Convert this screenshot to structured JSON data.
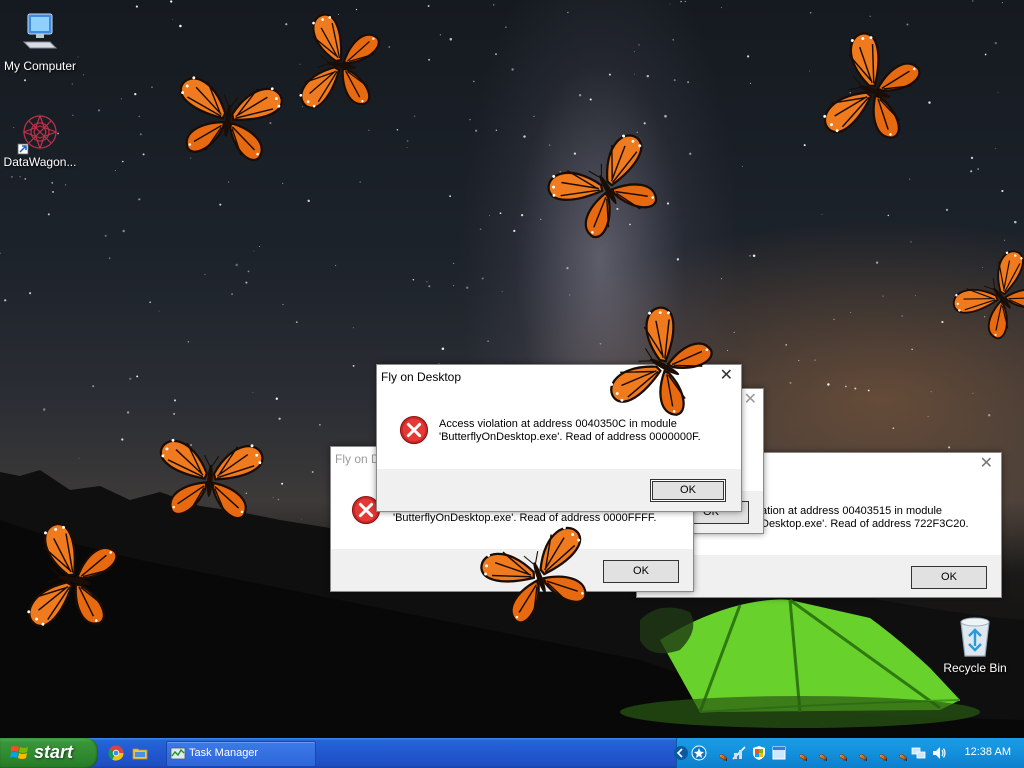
{
  "desktop": {
    "icons": [
      {
        "label": "My Computer",
        "icon": "my-computer-icon"
      },
      {
        "label": "DataWagon...",
        "icon": "datawagon-icon"
      },
      {
        "label": "Recycle Bin",
        "icon": "recycle-bin-icon"
      }
    ]
  },
  "dialogs": [
    {
      "title": "Fly on Desktop",
      "line1": "Access violation at address 0040350C in module",
      "line2": "'ButterflyOnDesktop.exe'. Read of address 0000000F.",
      "ok_label": "OK"
    },
    {
      "title": "Fly on D",
      "line1": "",
      "line2": "'ButterflyOnDesktop.exe'. Read of address 0000FFFF.",
      "ok_label": "OK"
    },
    {
      "title": "",
      "line1": "ation at address 00403515 in module",
      "line2": "Desktop.exe'. Read of address 722F3C20.",
      "ok_label": "OK"
    },
    {
      "title": "",
      "ok_label": "OK"
    }
  ],
  "taskbar": {
    "start_label": "start",
    "quick_launch": [
      "chrome-icon",
      "folder-icon"
    ],
    "tasks": [
      {
        "label": "Task Manager",
        "icon": "task-manager-icon"
      }
    ],
    "tray_icons": [
      "chevron-left-icon",
      "star-icon",
      "network-muted-icon",
      "shield-flag-icon",
      "window-icon",
      "butterfly-icon",
      "network-icon",
      "speaker-icon"
    ],
    "clock": "12:38 AM"
  },
  "colors": {
    "butterfly_orange": "#f07a1e",
    "error_red": "#d32f2f",
    "taskbar_blue": "#2257d0",
    "start_green": "#2f8a2f",
    "tray_blue": "#1390dc"
  }
}
